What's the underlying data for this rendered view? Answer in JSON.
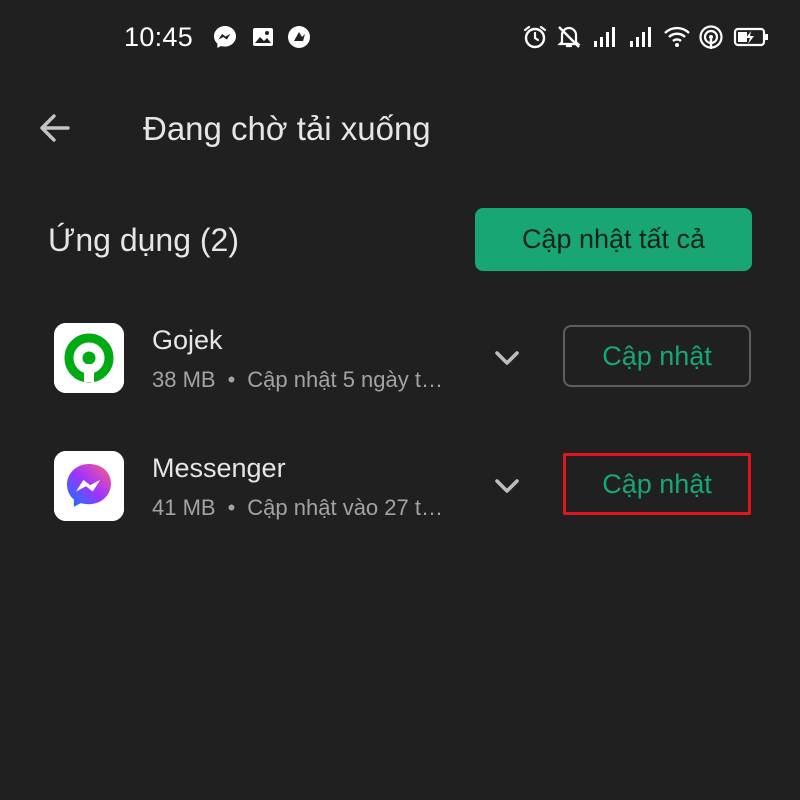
{
  "status_bar": {
    "time": "10:45",
    "left_icons": [
      "messenger-icon",
      "image-icon",
      "notification-icon"
    ],
    "right_icons": [
      "alarm-icon",
      "mute-icon",
      "signal-icon",
      "signal-icon",
      "wifi-icon",
      "hotspot-icon",
      "battery-charging-icon"
    ]
  },
  "header": {
    "back_icon": "back-arrow-icon",
    "title": "Đang chờ tải xuống"
  },
  "section": {
    "title": "Ứng dụng (2)",
    "update_all_label": "Cập nhật tất cả"
  },
  "apps": [
    {
      "name": "Gojek",
      "size": "38 MB",
      "separator": "•",
      "status": "Cập nhật 5 ngày t…",
      "icon": "gojek-icon",
      "button_label": "Cập nhật"
    },
    {
      "name": "Messenger",
      "size": "41 MB",
      "separator": "•",
      "status": "Cập nhật vào 27 t…",
      "icon": "messenger-icon",
      "button_label": "Cập nhật",
      "highlighted": true
    }
  ],
  "colors": {
    "background": "#202020",
    "accent": "#18a774",
    "highlight": "#e0161f"
  }
}
